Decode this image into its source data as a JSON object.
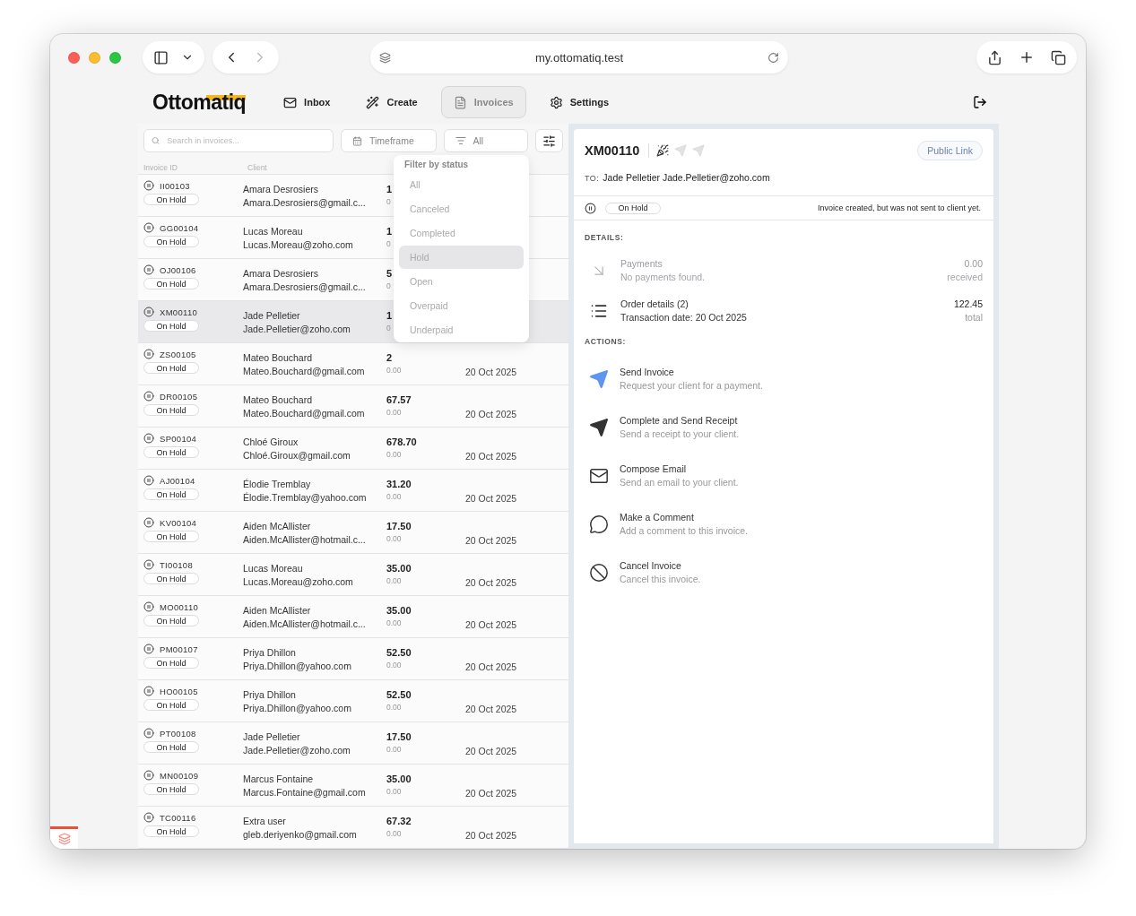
{
  "browser": {
    "url": "my.ottomatiq.test"
  },
  "nav": {
    "logo": "Ottomatiq",
    "items": [
      {
        "kind": "inbox",
        "label": "Inbox",
        "selected": false
      },
      {
        "kind": "create",
        "label": "Create",
        "selected": false
      },
      {
        "kind": "invoices",
        "label": "Invoices",
        "selected": true
      },
      {
        "kind": "settings",
        "label": "Settings",
        "selected": false
      }
    ]
  },
  "list": {
    "search_placeholder": "Search in invoices...",
    "timeframe": "Timeframe",
    "status_filter": "All",
    "columns": [
      "Invoice ID",
      "Client"
    ],
    "rows": [
      {
        "id": "II00103",
        "status": "On Hold",
        "client": "Amara Desrosiers",
        "email": "Amara.Desrosiers@gmail.c...",
        "amount": "1",
        "received": "0",
        "selected": false
      },
      {
        "id": "GG00104",
        "status": "On Hold",
        "client": "Lucas Moreau",
        "email": "Lucas.Moreau@zoho.com",
        "amount": "1",
        "received": "0",
        "selected": false
      },
      {
        "id": "OJ00106",
        "status": "On Hold",
        "client": "Amara Desrosiers",
        "email": "Amara.Desrosiers@gmail.c...",
        "amount": "5",
        "received": "0",
        "selected": false
      },
      {
        "id": "XM00110",
        "status": "On Hold",
        "client": "Jade Pelletier",
        "email": "Jade.Pelletier@zoho.com",
        "amount": "1",
        "received": "0",
        "selected": true
      },
      {
        "id": "ZS00105",
        "status": "On Hold",
        "client": "Mateo Bouchard",
        "email": "Mateo.Bouchard@gmail.com",
        "amount": "2",
        "received": "0.00",
        "date": "20 Oct 2025",
        "selected": false
      },
      {
        "id": "DR00105",
        "status": "On Hold",
        "client": "Mateo Bouchard",
        "email": "Mateo.Bouchard@gmail.com",
        "amount": "67.57",
        "received": "0.00",
        "date": "20 Oct 2025",
        "selected": false
      },
      {
        "id": "SP00104",
        "status": "On Hold",
        "client": "Chloé Giroux",
        "email": "Chloé.Giroux@gmail.com",
        "amount": "678.70",
        "received": "0.00",
        "date": "20 Oct 2025",
        "selected": false
      },
      {
        "id": "AJ00104",
        "status": "On Hold",
        "client": "Élodie Tremblay",
        "email": "Élodie.Tremblay@yahoo.com",
        "amount": "31.20",
        "received": "0.00",
        "date": "20 Oct 2025",
        "selected": false
      },
      {
        "id": "KV00104",
        "status": "On Hold",
        "client": "Aiden McAllister",
        "email": "Aiden.McAllister@hotmail.c...",
        "amount": "17.50",
        "received": "0.00",
        "date": "20 Oct 2025",
        "selected": false
      },
      {
        "id": "TI00108",
        "status": "On Hold",
        "client": "Lucas Moreau",
        "email": "Lucas.Moreau@zoho.com",
        "amount": "35.00",
        "received": "0.00",
        "date": "20 Oct 2025",
        "selected": false
      },
      {
        "id": "MO00110",
        "status": "On Hold",
        "client": "Aiden McAllister",
        "email": "Aiden.McAllister@hotmail.c...",
        "amount": "35.00",
        "received": "0.00",
        "date": "20 Oct 2025",
        "selected": false
      },
      {
        "id": "PM00107",
        "status": "On Hold",
        "client": "Priya Dhillon",
        "email": "Priya.Dhillon@yahoo.com",
        "amount": "52.50",
        "received": "0.00",
        "date": "20 Oct 2025",
        "selected": false
      },
      {
        "id": "HO00105",
        "status": "On Hold",
        "client": "Priya Dhillon",
        "email": "Priya.Dhillon@yahoo.com",
        "amount": "52.50",
        "received": "0.00",
        "date": "20 Oct 2025",
        "selected": false
      },
      {
        "id": "PT00108",
        "status": "On Hold",
        "client": "Jade Pelletier",
        "email": "Jade.Pelletier@zoho.com",
        "amount": "17.50",
        "received": "0.00",
        "date": "20 Oct 2025",
        "selected": false
      },
      {
        "id": "MN00109",
        "status": "On Hold",
        "client": "Marcus Fontaine",
        "email": "Marcus.Fontaine@gmail.com",
        "amount": "35.00",
        "received": "0.00",
        "date": "20 Oct 2025",
        "selected": false
      },
      {
        "id": "TC00116",
        "status": "On Hold",
        "client": "Extra user",
        "email": "gleb.deriyenko@gmail.com",
        "amount": "67.32",
        "received": "0.00",
        "date": "20 Oct 2025",
        "selected": false
      }
    ]
  },
  "status_menu": {
    "title": "Filter by status",
    "options": [
      {
        "label": "All",
        "selected": false
      },
      {
        "label": "Canceled",
        "selected": false
      },
      {
        "label": "Completed",
        "selected": false
      },
      {
        "label": "Hold",
        "selected": true
      },
      {
        "label": "Open",
        "selected": false
      },
      {
        "label": "Overpaid",
        "selected": false
      },
      {
        "label": "Underpaid",
        "selected": false
      }
    ]
  },
  "detail": {
    "invoice_id": "XM00110",
    "public_link": "Public Link",
    "to_label": "TO:",
    "to": "Jade Pelletier Jade.Pelletier@zoho.com",
    "status": "On Hold",
    "status_note": "Invoice created, but was not sent to client yet.",
    "details_heading": "DETAILS:",
    "details": [
      {
        "kind": "payments",
        "title": "Payments",
        "subtitle": "No payments found.",
        "value": "0.00",
        "value_label": "received",
        "disabled": true
      },
      {
        "kind": "order",
        "title": "Order details (2)",
        "subtitle": "Transaction date: 20 Oct 2025",
        "value": "122.45",
        "value_label": "total",
        "disabled": false
      }
    ],
    "actions_heading": "ACTIONS:",
    "actions": [
      {
        "kind": "request",
        "title": "Send Invoice",
        "subtitle": "Request your client for a payment."
      },
      {
        "kind": "receipt",
        "title": "Complete and Send Receipt",
        "subtitle": "Send a receipt to your client."
      },
      {
        "kind": "email",
        "title": "Compose Email",
        "subtitle": "Send an email to your client."
      },
      {
        "kind": "comment",
        "title": "Make a Comment",
        "subtitle": "Add a comment to this invoice."
      },
      {
        "kind": "cancel",
        "title": "Cancel Invoice",
        "subtitle": "Cancel this invoice."
      }
    ]
  }
}
